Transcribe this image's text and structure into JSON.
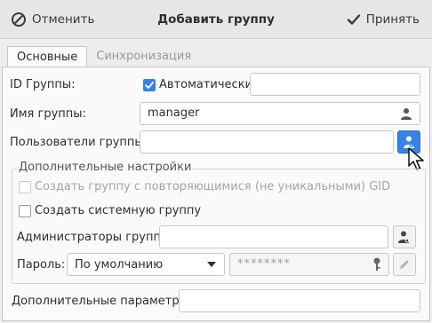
{
  "titlebar": {
    "cancel_label": "Отменить",
    "title": "Добавить группу",
    "accept_label": "Принять"
  },
  "tabs": [
    {
      "label": "Основные",
      "active": true
    },
    {
      "label": "Синхронизация",
      "active": false
    }
  ],
  "form": {
    "group_id": {
      "label": "ID Группы:",
      "auto_label": "Автоматически",
      "auto_checked": true,
      "value": ""
    },
    "group_name": {
      "label": "Имя группы:",
      "value": "manager"
    },
    "group_users": {
      "label": "Пользователи группы:",
      "value": ""
    },
    "advanced": {
      "title": "Дополнительные настройки",
      "nonunique_gid": {
        "label": "Создать группу с повторяющимися (не уникальными) GID",
        "checked": false,
        "enabled": false
      },
      "system_group": {
        "label": "Создать системную группу",
        "checked": false
      },
      "admins": {
        "label": "Администраторы группы:",
        "value": ""
      },
      "password": {
        "label": "Пароль:",
        "mode": "По умолчанию",
        "value": "********"
      }
    },
    "extra_params": {
      "label": "Дополнительные параметры:",
      "value": ""
    }
  },
  "colors": {
    "accent": "#3584e4",
    "panel": "#fafafa",
    "window": "#ededed"
  }
}
